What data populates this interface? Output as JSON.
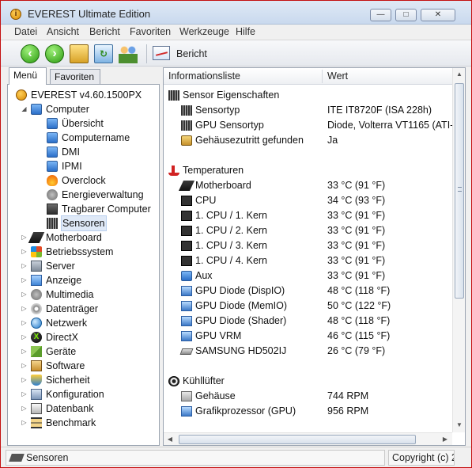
{
  "window": {
    "title": "EVEREST Ultimate Edition"
  },
  "menubar": [
    "Datei",
    "Ansicht",
    "Bericht",
    "Favoriten",
    "Werkzeuge",
    "Hilfe"
  ],
  "toolbar": {
    "report_label": "Bericht"
  },
  "tabs": [
    "Menü",
    "Favoriten"
  ],
  "tree": [
    {
      "label": "EVEREST v4.60.1500PX",
      "icon": "info-icon"
    },
    {
      "label": "Computer",
      "icon": "computer-icon"
    },
    {
      "label": "Übersicht",
      "icon": "computer-icon"
    },
    {
      "label": "Computername",
      "icon": "computer-icon"
    },
    {
      "label": "DMI",
      "icon": "computer-icon"
    },
    {
      "label": "IPMI",
      "icon": "computer-icon"
    },
    {
      "label": "Overclock",
      "icon": "fire-icon"
    },
    {
      "label": "Energieverwaltung",
      "icon": "power-icon"
    },
    {
      "label": "Tragbarer Computer",
      "icon": "laptop-icon"
    },
    {
      "label": "Sensoren",
      "icon": "sensor-icon"
    },
    {
      "label": "Motherboard",
      "icon": "motherboard-icon"
    },
    {
      "label": "Betriebssystem",
      "icon": "windows-icon"
    },
    {
      "label": "Server",
      "icon": "server-icon"
    },
    {
      "label": "Anzeige",
      "icon": "monitor-icon"
    },
    {
      "label": "Multimedia",
      "icon": "speaker-icon"
    },
    {
      "label": "Datenträger",
      "icon": "disc-icon"
    },
    {
      "label": "Netzwerk",
      "icon": "globe-icon"
    },
    {
      "label": "DirectX",
      "icon": "directx-icon"
    },
    {
      "label": "Geräte",
      "icon": "devices-icon"
    },
    {
      "label": "Software",
      "icon": "software-icon"
    },
    {
      "label": "Sicherheit",
      "icon": "shield-icon"
    },
    {
      "label": "Konfiguration",
      "icon": "config-icon"
    },
    {
      "label": "Datenbank",
      "icon": "database-icon"
    },
    {
      "label": "Benchmark",
      "icon": "hourglass-icon"
    }
  ],
  "list": {
    "headers": [
      "Informationsliste",
      "Wert"
    ],
    "rows": [
      {
        "type": "section",
        "label": "Sensor Eigenschaften",
        "icon": "sensor-icon"
      },
      {
        "type": "item",
        "label": "Sensortyp",
        "value": "ITE IT8720F  (ISA 228h)",
        "icon": "sensor-icon"
      },
      {
        "type": "item",
        "label": "GPU Sensortyp",
        "value": "Diode, Volterra VT1165  (ATI-D",
        "icon": "sensor-icon"
      },
      {
        "type": "item",
        "label": "Gehäusezutritt gefunden",
        "value": "Ja",
        "icon": "lock-icon"
      },
      {
        "type": "spacer"
      },
      {
        "type": "section",
        "label": "Temperaturen",
        "icon": "thermometer-icon"
      },
      {
        "type": "item",
        "label": "Motherboard",
        "value": "33 °C  (91 °F)",
        "icon": "motherboard-icon"
      },
      {
        "type": "item",
        "label": "CPU",
        "value": "34 °C  (93 °F)",
        "icon": "cpu-icon"
      },
      {
        "type": "item",
        "label": "1. CPU / 1. Kern",
        "value": "33 °C  (91 °F)",
        "icon": "cpu-icon"
      },
      {
        "type": "item",
        "label": "1. CPU / 2. Kern",
        "value": "33 °C  (91 °F)",
        "icon": "cpu-icon"
      },
      {
        "type": "item",
        "label": "1. CPU / 3. Kern",
        "value": "33 °C  (91 °F)",
        "icon": "cpu-icon"
      },
      {
        "type": "item",
        "label": "1. CPU / 4. Kern",
        "value": "33 °C  (91 °F)",
        "icon": "cpu-icon"
      },
      {
        "type": "item",
        "label": "Aux",
        "value": "33 °C  (91 °F)",
        "icon": "computer-icon"
      },
      {
        "type": "item",
        "label": "GPU Diode (DispIO)",
        "value": "48 °C  (118 °F)",
        "icon": "gpu-icon"
      },
      {
        "type": "item",
        "label": "GPU Diode (MemIO)",
        "value": "50 °C  (122 °F)",
        "icon": "gpu-icon"
      },
      {
        "type": "item",
        "label": "GPU Diode (Shader)",
        "value": "48 °C  (118 °F)",
        "icon": "gpu-icon"
      },
      {
        "type": "item",
        "label": "GPU VRM",
        "value": "46 °C  (115 °F)",
        "icon": "gpu-icon"
      },
      {
        "type": "item",
        "label": "SAMSUNG HD502IJ",
        "value": "26 °C  (79 °F)",
        "icon": "hdd-icon"
      },
      {
        "type": "spacer"
      },
      {
        "type": "section",
        "label": "Kühllüfter",
        "icon": "fan-icon"
      },
      {
        "type": "item",
        "label": "Gehäuse",
        "value": "744 RPM",
        "icon": "case-fan-icon"
      },
      {
        "type": "item",
        "label": "Grafikprozessor (GPU)",
        "value": "956 RPM",
        "icon": "gpu-icon"
      }
    ]
  },
  "statusbar": {
    "left": "Sensoren",
    "right": "Copyright (c) 2"
  }
}
